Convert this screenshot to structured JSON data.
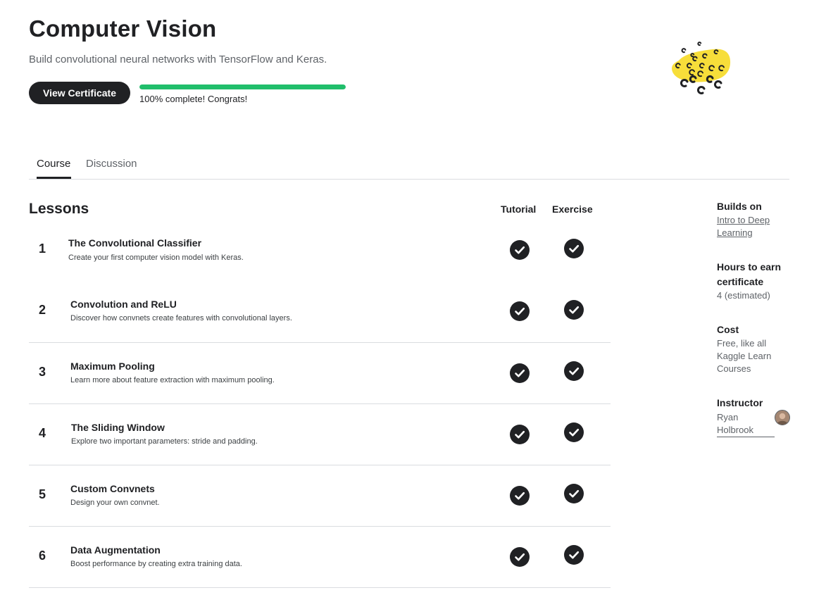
{
  "header": {
    "title": "Computer Vision",
    "subtitle": "Build convolutional neural networks with TensorFlow and Keras.",
    "cert_button": "View Certificate",
    "progress_percent": 100,
    "progress_text": "100% complete! Congrats!"
  },
  "tabs": [
    {
      "label": "Course",
      "active": true
    },
    {
      "label": "Discussion",
      "active": false
    }
  ],
  "lessons": {
    "heading": "Lessons",
    "col_tutorial": "Tutorial",
    "col_exercise": "Exercise",
    "items": [
      {
        "num": "1",
        "title": "The Convolutional Classifier",
        "desc": "Create your first computer vision model with Keras.",
        "tutorial_done": true,
        "exercise_done": true
      },
      {
        "num": "2",
        "title": "Convolution and ReLU",
        "desc": "Discover how convnets create features with convolutional layers.",
        "tutorial_done": true,
        "exercise_done": true
      },
      {
        "num": "3",
        "title": "Maximum Pooling",
        "desc": "Learn more about feature extraction with maximum pooling.",
        "tutorial_done": true,
        "exercise_done": true
      },
      {
        "num": "4",
        "title": "The Sliding Window",
        "desc": "Explore two important parameters: stride and padding.",
        "tutorial_done": true,
        "exercise_done": true
      },
      {
        "num": "5",
        "title": "Custom Convnets",
        "desc": "Design your own convnet.",
        "tutorial_done": true,
        "exercise_done": true
      },
      {
        "num": "6",
        "title": "Data Augmentation",
        "desc": "Boost performance by creating extra training data.",
        "tutorial_done": true,
        "exercise_done": true
      }
    ]
  },
  "sidebar": {
    "builds_on_label": "Builds on",
    "builds_on_line1": "Intro to Deep",
    "builds_on_line2": "Learning",
    "hours_label_line1": "Hours to earn",
    "hours_label_line2": "certificate",
    "hours_value": "4 (estimated)",
    "cost_label": "Cost",
    "cost_line1": "Free, like all",
    "cost_line2": "Kaggle Learn",
    "cost_line3": "Courses",
    "instructor_label": "Instructor",
    "instructor_line1": "Ryan",
    "instructor_line2": "Holbrook"
  },
  "icons": {
    "check": "check-circle-icon",
    "logo": "course-logo"
  },
  "colors": {
    "accent_green": "#20be6b",
    "dark": "#202124",
    "logo_yellow": "#f7de3a"
  }
}
